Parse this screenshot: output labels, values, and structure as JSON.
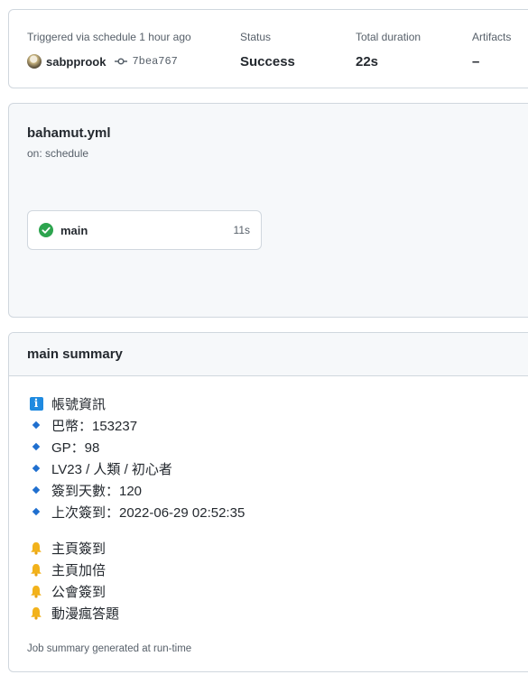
{
  "run": {
    "trigger_text": "Triggered via schedule 1 hour ago",
    "actor": "sabpprook",
    "commit_sha": "7bea767",
    "status_label": "Status",
    "status_value": "Success",
    "duration_label": "Total duration",
    "duration_value": "22s",
    "artifacts_label": "Artifacts",
    "artifacts_value": "–"
  },
  "workflow": {
    "file": "bahamut.yml",
    "trigger": "on: schedule",
    "job": {
      "name": "main",
      "duration": "11s",
      "status": "success"
    }
  },
  "summary": {
    "title": "main summary",
    "info_heading": "帳號資訊",
    "info_items": [
      "巴幣：153237",
      "GP：98",
      "LV23 / 人類 / 初心者",
      "簽到天數：120",
      "上次簽到：2022-06-29 02:52:35"
    ],
    "tasks": [
      "主頁簽到",
      "主頁加倍",
      "公會簽到",
      "動漫瘋答題"
    ],
    "footer": "Job summary generated at run-time"
  },
  "colors": {
    "success": "#2da44e",
    "bell": "#f2b21b",
    "diamond": "#1f6fcf",
    "info": "#1f8ae0"
  },
  "icons": [
    "avatar",
    "git-commit-icon",
    "check-circle-icon",
    "info-icon",
    "diamond-bullet-icon",
    "bell-icon"
  ]
}
